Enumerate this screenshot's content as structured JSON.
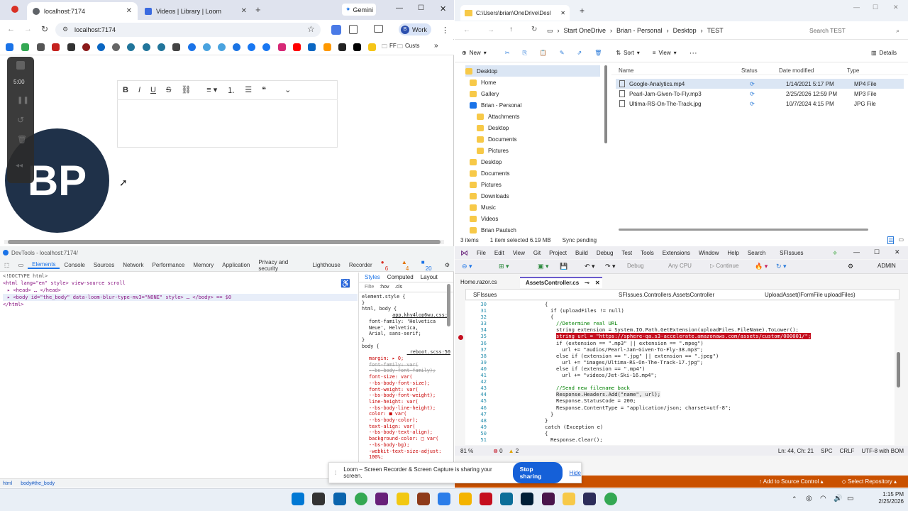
{
  "browser": {
    "tabs": [
      {
        "label": "localhost:7174"
      },
      {
        "label": "Videos | Library | Loom"
      }
    ],
    "gemini": "Gemini",
    "url": "localhost:7174",
    "profile": "Work",
    "bookmark_ff": "FF",
    "bookmark_custs": "Custs",
    "loom_timer": "5:00",
    "avatar_initials": "BP"
  },
  "devtools": {
    "title": "DevTools - localhost:7174/",
    "tabs": [
      "Elements",
      "Console",
      "Sources",
      "Network",
      "Performance",
      "Memory",
      "Application",
      "Privacy and security",
      "Lighthouse",
      "Recorder"
    ],
    "errors": "6",
    "warnings": "4",
    "issues": "20",
    "dom": [
      "<!DOCTYPE html>",
      "<html lang=\"en\" style> view-source scroll",
      "▸ <head> … </head>",
      "▸ <body id=\"the_body\" data-loom-blur-type-mv3=\"NONE\" style> … </body> == $0",
      "</html>"
    ],
    "style_tabs": [
      "Styles",
      "Computed",
      "Layout"
    ],
    "filter": "Filte",
    "hov": ":hov",
    "cls": ".cls",
    "styles": [
      "element.style {",
      "}",
      "html, body {",
      "app.khy4lop6wu.css:1",
      "font-family: 'Helvetica",
      "Neue', Helvetica,",
      "Arial, sans-serif;",
      "}",
      "body {",
      "_reboot.scss:50",
      "margin: ▸ 0;",
      "font-family: var(",
      "--bs-body-font-family);",
      "font-size: var(",
      "--bs-body-font-size);",
      "font-weight: var(",
      "--bs-body-font-weight);",
      "line-height: var(",
      "--bs-body-line-height);",
      "color: ■ var(",
      "--bs-body-color);",
      "text-align: var(",
      "--bs-body-text-align);",
      "background-color: □ var(",
      "--bs-body-bg);",
      "-webkit-text-size-adjust:",
      "100%;"
    ],
    "crumbs": [
      "html",
      "body#the_body"
    ]
  },
  "explorer": {
    "title": "C:\\Users\\brian\\OneDrive\\Desl",
    "breadcrumb": [
      "Start OneDrive",
      "Brian - Personal",
      "Desktop",
      "TEST"
    ],
    "search": "Search TEST",
    "cmd": {
      "new": "New",
      "sort": "Sort",
      "view": "View",
      "details": "Details"
    },
    "sidebar": [
      "Desktop",
      "Home",
      "Gallery",
      "Brian - Personal",
      "Attachments",
      "Desktop",
      "Documents",
      "Pictures",
      "Desktop",
      "Documents",
      "Pictures",
      "Downloads",
      "Music",
      "Videos",
      "Brian Pautsch"
    ],
    "columns": [
      "Name",
      "Status",
      "Date modified",
      "Type"
    ],
    "files": [
      {
        "name": "Google-Analytics.mp4",
        "date": "1/14/2021 5:17 PM",
        "type": "MP4 File"
      },
      {
        "name": "Pearl-Jam-Given-To-Fly.mp3",
        "date": "2/25/2026 12:59 PM",
        "type": "MP3 File"
      },
      {
        "name": "Ultima-RS-On-The-Track.jpg",
        "date": "10/7/2024 4:15 PM",
        "type": "JPG File"
      }
    ],
    "status": [
      "3 items",
      "1 item selected 6.19 MB",
      "Sync pending"
    ]
  },
  "vs": {
    "menu": [
      "File",
      "Edit",
      "View",
      "Git",
      "Project",
      "Build",
      "Debug",
      "Test",
      "Tools",
      "Extensions",
      "Window",
      "Help",
      "Search",
      "SFIssues"
    ],
    "debug": "Debug",
    "cpu": "Any CPU",
    "continue": "Continue",
    "admin": "ADMIN",
    "tabs": [
      "Home.razor.cs",
      "AssetsController.cs"
    ],
    "nav": [
      "SFIssues",
      "SFIssues.Controllers.AssetsController",
      "UploadAsset(IFormFile uploadFiles)"
    ],
    "lines": [
      {
        "n": "30",
        "t": "{"
      },
      {
        "n": "31",
        "t": "if (uploadFiles != null)"
      },
      {
        "n": "32",
        "t": "{"
      },
      {
        "n": "33",
        "t": "//Determine real URL"
      },
      {
        "n": "34",
        "t": "string extension = System.IO.Path.GetExtension(uploadFiles.FileName).ToLower();"
      },
      {
        "n": "35",
        "t": "string url = \"https://sphere-qa.s3-accelerate.amazonaws.com/assets/custom/000001/\";"
      },
      {
        "n": "36",
        "t": "if (extension == \".mp3\" || extension == \".mpeg\")"
      },
      {
        "n": "37",
        "t": "url += \"audios/Pearl-Jam-Given-To-Fly-38.mp3\";"
      },
      {
        "n": "38",
        "t": "else if (extension == \".jpg\" || extension == \".jpeg\")"
      },
      {
        "n": "39",
        "t": "url += \"images/Ultima-RS-On-The-Track-17.jpg\";"
      },
      {
        "n": "40",
        "t": "else if (extension == \".mp4\")"
      },
      {
        "n": "41",
        "t": "url += \"videos/Jet-Ski-16.mp4\";"
      },
      {
        "n": "42",
        "t": ""
      },
      {
        "n": "43",
        "t": "//Send new filename back"
      },
      {
        "n": "44",
        "t": "Response.Headers.Add(\"name\", url);"
      },
      {
        "n": "45",
        "t": "Response.StatusCode = 200;"
      },
      {
        "n": "46",
        "t": "Response.ContentType = \"application/json; charset=utf-8\";"
      },
      {
        "n": "47",
        "t": "}"
      },
      {
        "n": "48",
        "t": "}"
      },
      {
        "n": "49",
        "t": "catch (Exception e)"
      },
      {
        "n": "50",
        "t": "{"
      },
      {
        "n": "51",
        "t": "Response.Clear();"
      }
    ],
    "zoom": "81 %",
    "err": "0",
    "warn": "2",
    "status": {
      "pos": "Ln: 44, Ch: 21",
      "spc": "SPC",
      "crlf": "CRLF",
      "enc": "UTF-8 with BOM"
    },
    "bottom": {
      "add": "Add to Source Control",
      "repo": "Select Repository"
    }
  },
  "loom_share": {
    "text": "Loom – Screen Recorder & Screen Capture is sharing your screen.",
    "stop": "Stop sharing",
    "hide": "Hide"
  },
  "taskbar": {
    "time": "1:15 PM",
    "date": "2/25/2026"
  },
  "colors": {
    "avatar": "#1f3149",
    "accent": "#1560d8",
    "vs_status": "#ca5100"
  }
}
